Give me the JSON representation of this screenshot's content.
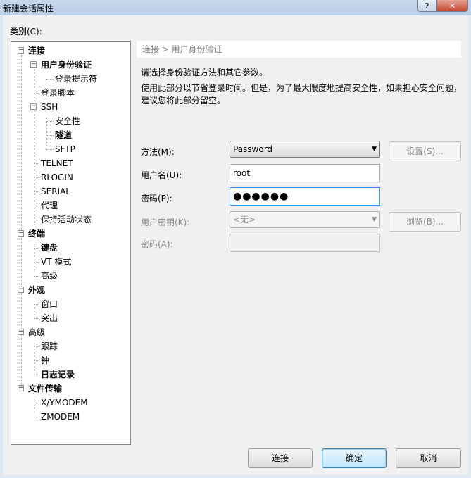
{
  "window": {
    "title": "新建会话属性",
    "help_glyph": "?",
    "close_glyph": "✕"
  },
  "category_label": "类别(C):",
  "tree": [
    {
      "label": "连接",
      "level": 0,
      "bold": true,
      "toggle": "−"
    },
    {
      "label": "用户身份验证",
      "level": 1,
      "bold": true,
      "toggle": "−",
      "selected": true
    },
    {
      "label": "登录提示符",
      "level": 2,
      "bold": false
    },
    {
      "label": "登录脚本",
      "level": 1,
      "bold": false
    },
    {
      "label": "SSH",
      "level": 1,
      "bold": false,
      "toggle": "−"
    },
    {
      "label": "安全性",
      "level": 2,
      "bold": false
    },
    {
      "label": "隧道",
      "level": 2,
      "bold": true
    },
    {
      "label": "SFTP",
      "level": 2,
      "bold": false
    },
    {
      "label": "TELNET",
      "level": 1,
      "bold": false
    },
    {
      "label": "RLOGIN",
      "level": 1,
      "bold": false
    },
    {
      "label": "SERIAL",
      "level": 1,
      "bold": false
    },
    {
      "label": "代理",
      "level": 1,
      "bold": false
    },
    {
      "label": "保持活动状态",
      "level": 1,
      "bold": false
    },
    {
      "label": "终端",
      "level": 0,
      "bold": true,
      "toggle": "−"
    },
    {
      "label": "键盘",
      "level": 1,
      "bold": true
    },
    {
      "label": "VT 模式",
      "level": 1,
      "bold": false
    },
    {
      "label": "高级",
      "level": 1,
      "bold": false
    },
    {
      "label": "外观",
      "level": 0,
      "bold": true,
      "toggle": "−"
    },
    {
      "label": "窗口",
      "level": 1,
      "bold": false
    },
    {
      "label": "突出",
      "level": 1,
      "bold": false
    },
    {
      "label": "高级",
      "level": 0,
      "bold": false,
      "toggle": "−"
    },
    {
      "label": "跟踪",
      "level": 1,
      "bold": false
    },
    {
      "label": "钟",
      "level": 1,
      "bold": false
    },
    {
      "label": "日志记录",
      "level": 1,
      "bold": true
    },
    {
      "label": "文件传输",
      "level": 0,
      "bold": true,
      "toggle": "−"
    },
    {
      "label": "X/YMODEM",
      "level": 1,
      "bold": false
    },
    {
      "label": "ZMODEM",
      "level": 1,
      "bold": false
    }
  ],
  "panel": {
    "breadcrumb": "连接 > 用户身份验证",
    "description": "请选择身份验证方法和其它参数。",
    "hint": "使用此部分以节省登录时间。但是，为了最大限度地提高安全性，如果担心安全问题，建议您将此部分留空。"
  },
  "form": {
    "method_label": "方法(M):",
    "method_value": "Password",
    "settings_button": "设置(S)...",
    "username_label": "用户名(U):",
    "username_value": "root",
    "password_label": "密码(P):",
    "password_value": "●●●●●●",
    "user_key_label": "用户密钥(K):",
    "user_key_value": "<无>",
    "browse_button": "浏览(B)...",
    "passphrase_label": "密码(A):",
    "passphrase_value": ""
  },
  "footer": {
    "connect": "连接",
    "ok": "确定",
    "cancel": "取消"
  },
  "colors": {
    "selection_border": "#3399ff",
    "default_button": "#3c7fb1"
  }
}
